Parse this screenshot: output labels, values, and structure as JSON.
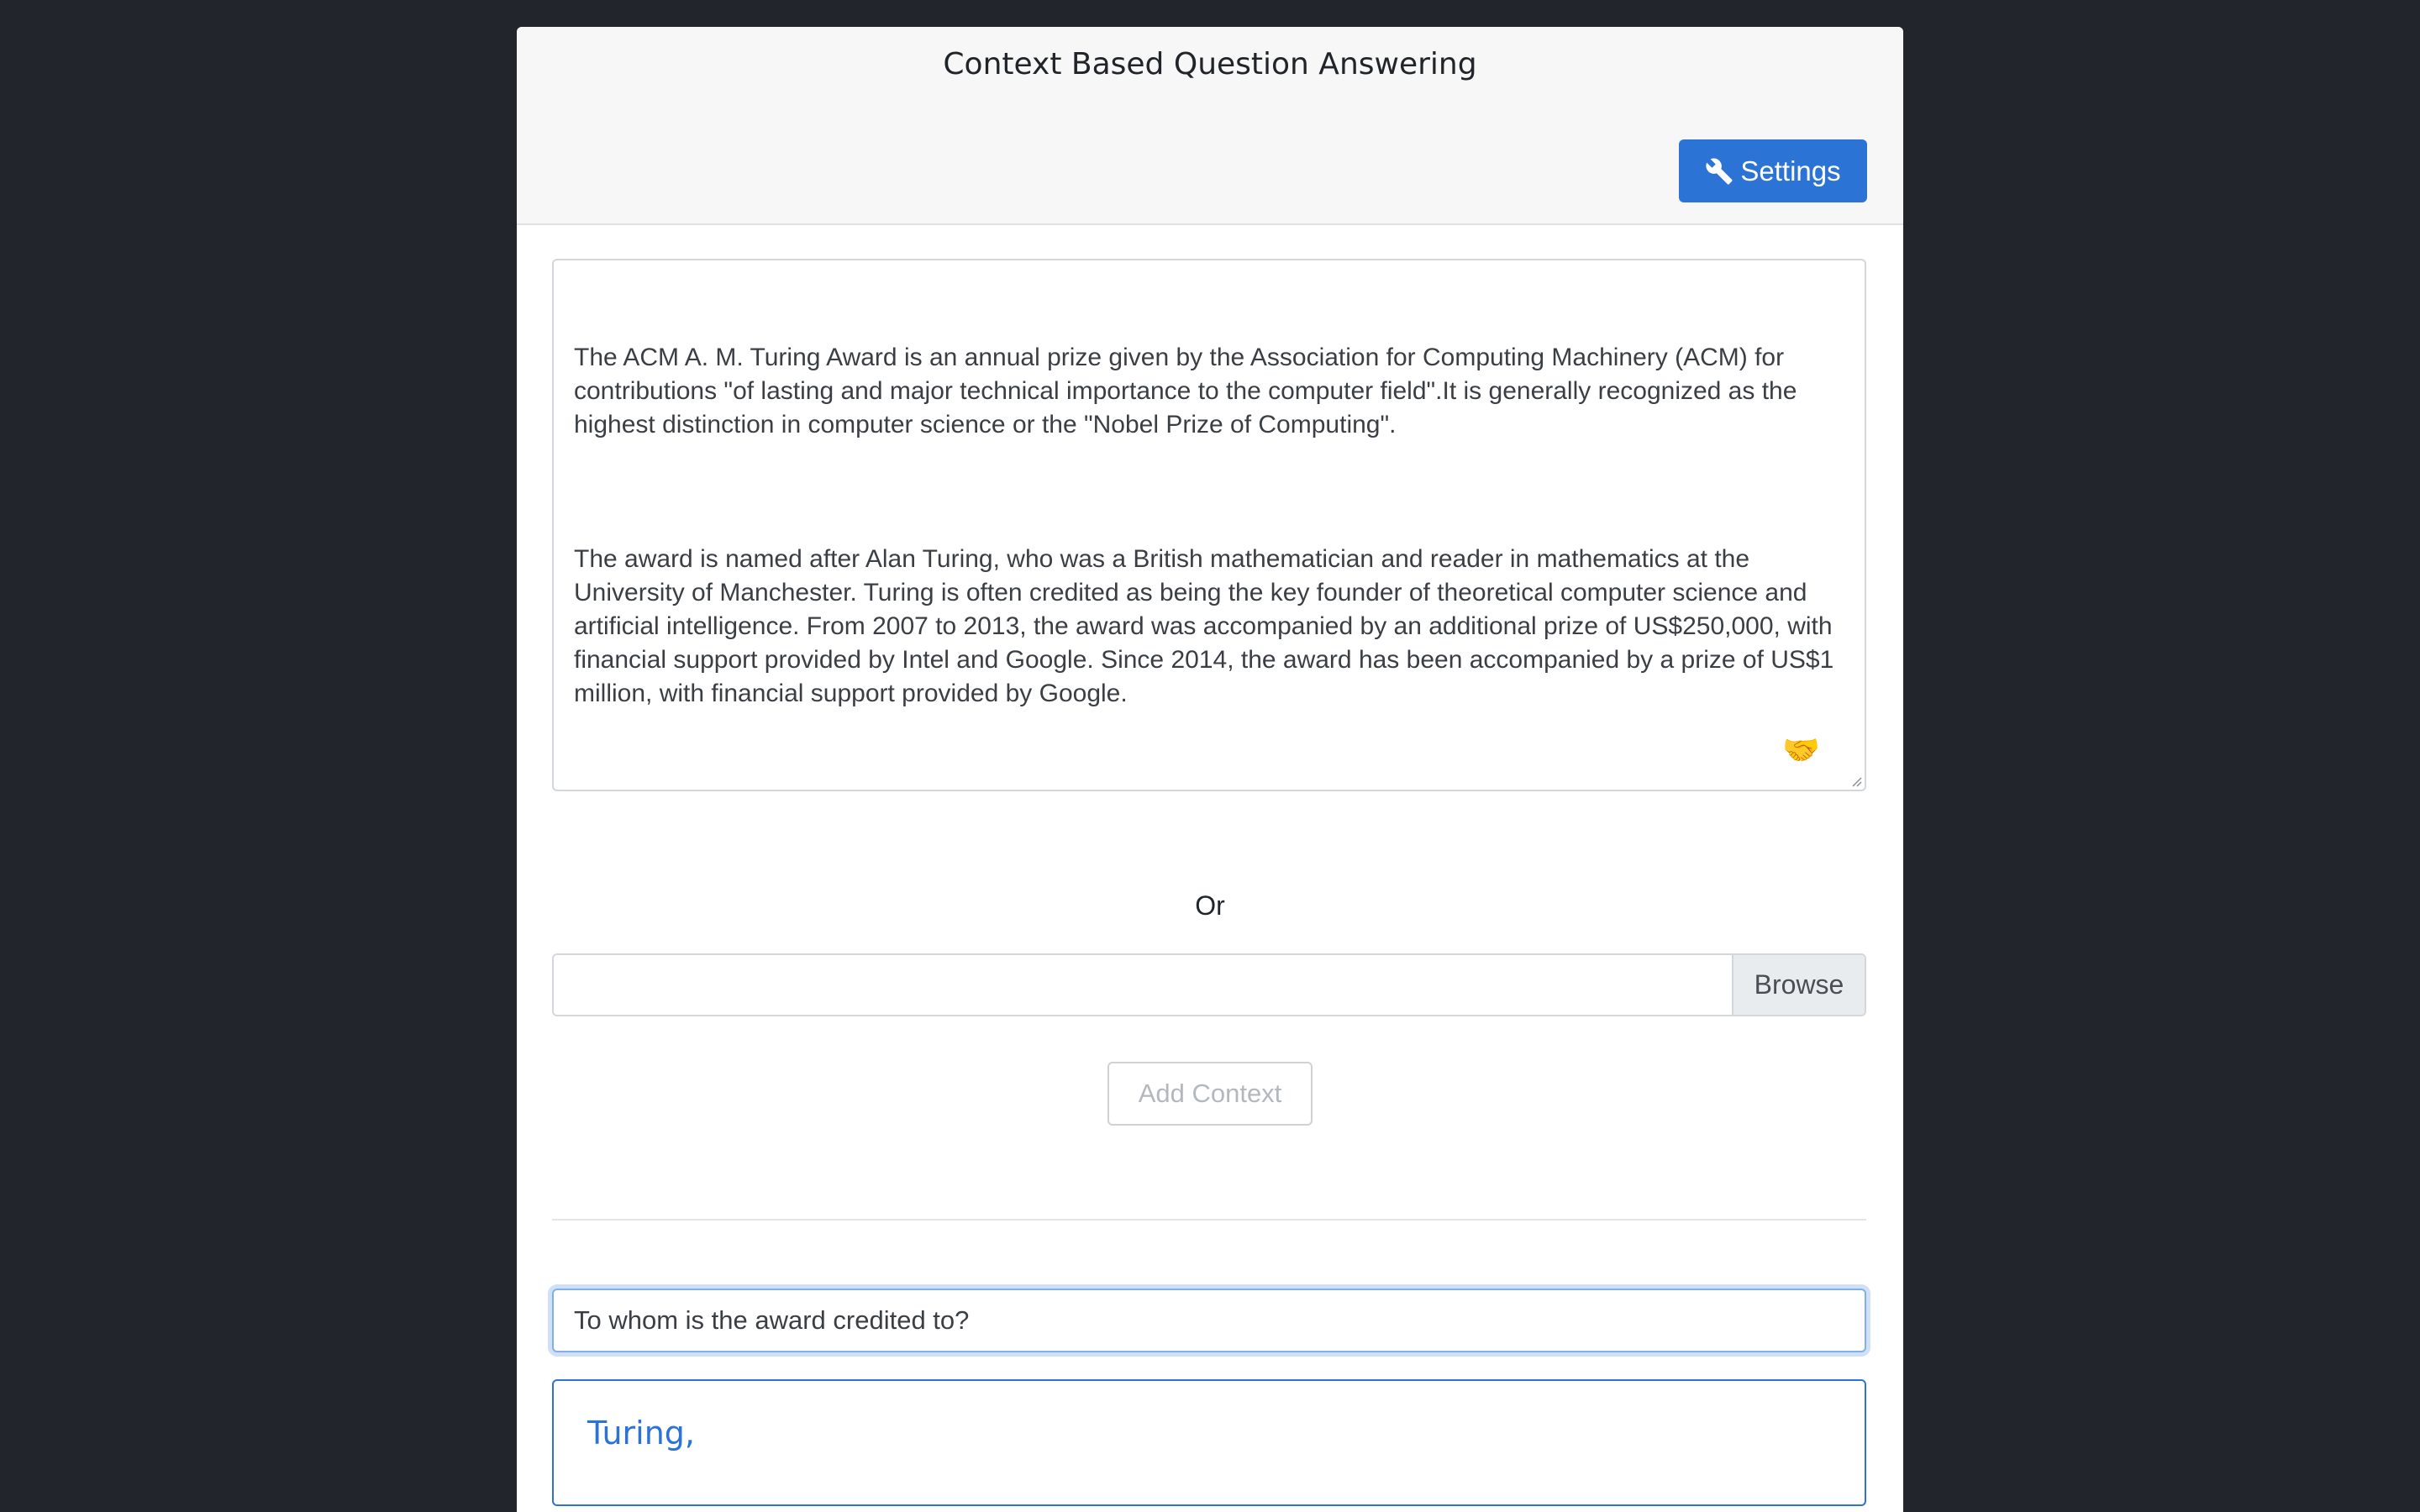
{
  "header": {
    "title": "Context Based Question Answering",
    "settings_label": "Settings",
    "settings_icon": "wrench-icon"
  },
  "context": {
    "paragraphs": [
      "The ACM A. M. Turing Award is an annual prize given by the Association for Computing Machinery (ACM) for contributions \"of lasting and major technical importance to the computer field\".It is generally recognized as the highest distinction in computer science or the \"Nobel Prize of Computing\".",
      "The award is named after Alan Turing, who was a British mathematician and reader in mathematics at the University of Manchester. Turing is often credited as being the key founder of theoretical computer science and artificial intelligence. From 2007 to 2013, the award was accompanied by an additional prize of US$250,000, with financial support provided by Intel and Google. Since 2014, the award has been accompanied by a prize of US$1 million, with financial support provided by Google."
    ]
  },
  "or_label": "Or",
  "file": {
    "value": "",
    "browse_label": "Browse"
  },
  "add_context_label": "Add Context",
  "question": {
    "value": "To whom is the award credited to?"
  },
  "answer": {
    "text": "Turing,"
  },
  "colors": {
    "background": "#22252c",
    "primary": "#2b73d4",
    "header_bg": "#f7f7f8"
  }
}
